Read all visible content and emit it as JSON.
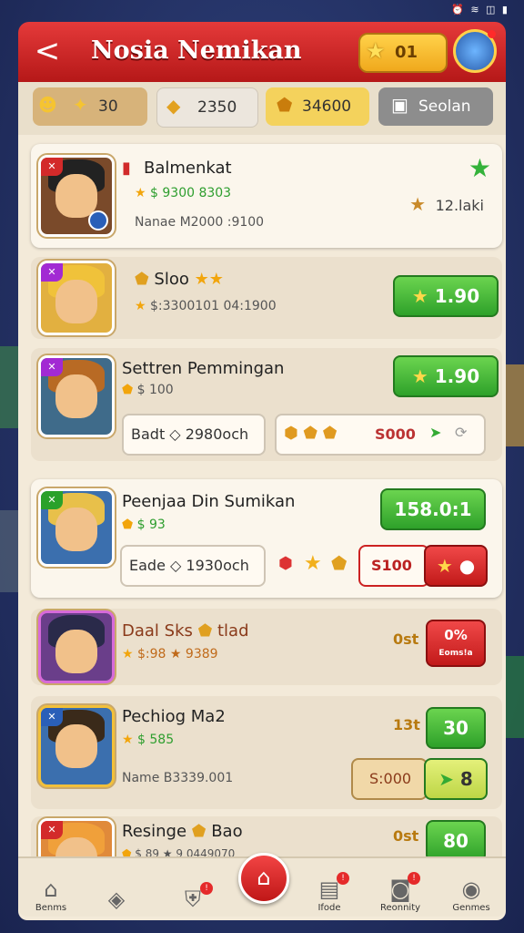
{
  "status": {
    "icons": "⏰ ≋ ◫ ▮"
  },
  "header": {
    "back": "<",
    "title": "Nosia Nemikan",
    "coins": "01"
  },
  "currency": [
    {
      "value": "30",
      "icon": "✦"
    },
    {
      "value": "2350",
      "icon": "◆"
    },
    {
      "value": "34600",
      "icon": "⬟"
    },
    {
      "value": "Seolan",
      "icon": "▣"
    }
  ],
  "rows": [
    {
      "name": "Balmenkat",
      "sub1": "$ 9300 8303",
      "sub2": "Nanae  M2000 :9100",
      "right": "12.laki"
    },
    {
      "name": "Sloo",
      "sub1": "$:3300101 04:1900",
      "price": "1.90"
    },
    {
      "name": "Settren Pemmingan",
      "sub1": "$ 100",
      "price": "1.90",
      "pill": "Badt  ◇ 2980och",
      "cost": "S000"
    },
    {
      "name": "Peenjaa Din Sumikan",
      "sub1": "$ 93",
      "price": "158.0:1",
      "pill": "Eade  ◇ 1930och",
      "cost": "S100"
    },
    {
      "name": "Daal Sks",
      "sub_extra": "tlad",
      "sub1": "$:98 ★ 9389",
      "tag": "0st",
      "red_top": "0%",
      "red_bottom": "Eoms!a"
    },
    {
      "name": "Pechiog Ma2",
      "sub1": "$ 585",
      "sub2": "Name  B3339.001",
      "tag": "13t",
      "price": "30",
      "cost": "S:000",
      "cost_num": "8"
    },
    {
      "name": "Resinge",
      "sub_extra": "Bao",
      "sub1": "$ 89 ★ 9 0449070",
      "tag": "0st",
      "price": "80"
    }
  ],
  "nav": [
    {
      "label": "Benms"
    },
    {
      "label": ""
    },
    {
      "label": ""
    },
    {
      "label": ""
    },
    {
      "label": "Ifode"
    },
    {
      "label": "Reonnity"
    },
    {
      "label": "Genmes"
    }
  ],
  "colors": {
    "header_red": "#d92c2c",
    "green": "#3fb83a",
    "gold": "#f2a50c",
    "panel": "#f3ead9"
  }
}
